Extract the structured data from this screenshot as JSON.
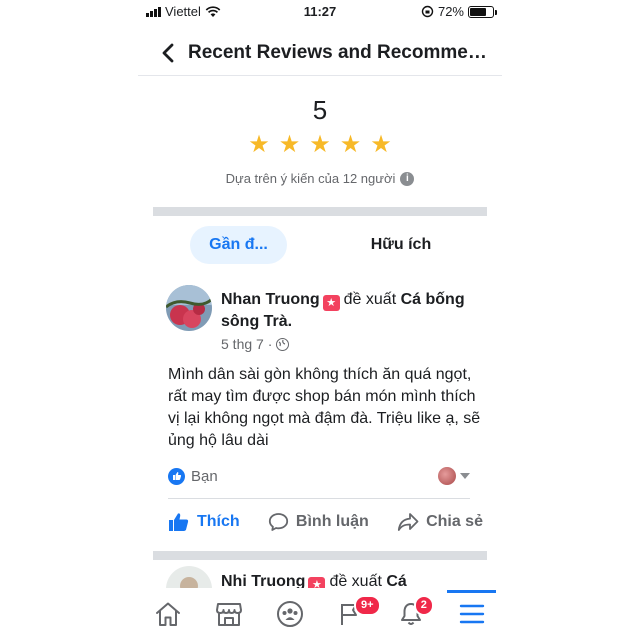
{
  "status_bar": {
    "carrier": "Viettel",
    "time": "11:27",
    "battery": "72%",
    "battery_level": 0.72
  },
  "header": {
    "title": "Recent Reviews and Recommen..."
  },
  "rating": {
    "value": "5",
    "stars": 5,
    "based_on": "Dựa trên ý kiến của 12 người"
  },
  "tabs": [
    {
      "label": "Gần đ..."
    },
    {
      "label": "Hữu ích"
    }
  ],
  "reviews": [
    {
      "author": "Nhan Truong",
      "verb": "đề xuất",
      "page": "Cá bống sông Trà.",
      "date": "5 thg 7 ·",
      "text": "Mình dân sài gòn không thích ăn quá ngọt, rất may tìm được shop bán món mình thích vị lại không ngọt mà đậm đà. Triệu like ạ, sẽ ủng hộ lâu dài",
      "reactions_label": "Bạn",
      "actions": {
        "like": "Thích",
        "comment": "Bình luận",
        "share": "Chia sẻ"
      }
    },
    {
      "author": "Nhi Truong",
      "verb": "đề xuất",
      "page": "Cá"
    }
  ],
  "nav": {
    "groups_badge": "9+",
    "notifications_badge": "2"
  },
  "colors": {
    "accent": "#1877f2",
    "star": "#f7b928",
    "badge": "#f02849"
  },
  "icons": [
    "back-icon",
    "star-icon",
    "info-icon",
    "globe-icon",
    "like-icon",
    "comment-icon",
    "share-icon",
    "home-icon",
    "marketplace-icon",
    "groups-icon",
    "flag-icon",
    "bell-icon",
    "menu-icon"
  ]
}
